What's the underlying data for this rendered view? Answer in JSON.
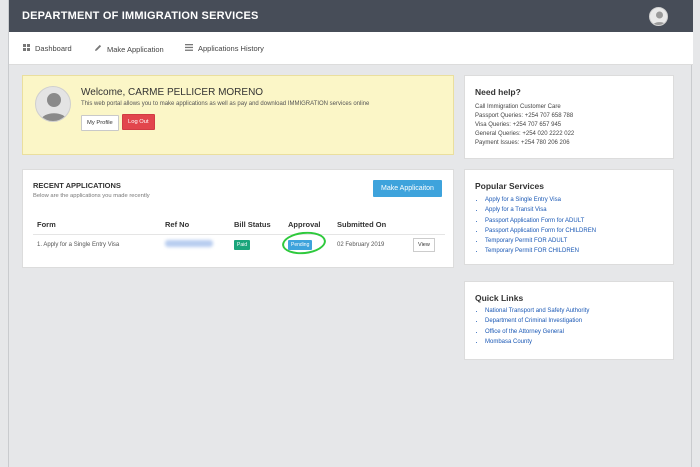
{
  "header": {
    "title": "DEPARTMENT OF IMMIGRATION SERVICES"
  },
  "nav": [
    {
      "label": "Dashboard",
      "icon": "dashboard-icon"
    },
    {
      "label": "Make Application",
      "icon": "pencil-icon"
    },
    {
      "label": "Applications History",
      "icon": "list-icon"
    }
  ],
  "welcome": {
    "title": "Welcome, CARME PELLICER MORENO",
    "subtitle": "This web portal allows you to make applications as well as pay and download IMMIGRATION services online",
    "profile_label": "My Profile",
    "logout_label": "Log Out"
  },
  "help": {
    "title": "Need help?",
    "lines": [
      "Call Immigration Customer Care",
      "Passport Queries: +254 707 658 788",
      "Visa Queries: +254 707 657 945",
      "General Queries: +254 020 2222 022",
      "Payment Issues: +254 780 206 206"
    ]
  },
  "recent": {
    "title": "RECENT APPLICATIONS",
    "subtitle": "Below are the applications you made recently",
    "make_label": "Make Applicaiton",
    "columns": [
      "Form",
      "Ref No",
      "Bill Status",
      "Approval",
      "Submitted On"
    ],
    "rows": [
      {
        "form": "1. Apply for a Single Entry Visa",
        "bill_status": "Paid",
        "approval": "Pending",
        "submitted": "02 February 2019",
        "action": "View"
      }
    ]
  },
  "popular": {
    "title": "Popular Services",
    "items": [
      "Apply for a Single Entry Visa",
      "Apply for a Transit Visa",
      "Passport Application Form for ADULT",
      "Passport Application Form for CHILDREN",
      "Temporary Permit FOR ADULT",
      "Temporary Permit FOR CHILDREN"
    ]
  },
  "quick": {
    "title": "Quick Links",
    "items": [
      "National Transport and Safety Authority",
      "Department of Criminal Investigation",
      "Office of the Attorney General",
      "Mombasa County"
    ]
  },
  "colors": {
    "header_bg": "#474d58",
    "welcome_bg": "#fbf6c7",
    "primary_blue": "#3ea3dc",
    "paid_green": "#1aa57b",
    "logout_red": "#e2454d",
    "link_blue": "#1a58b5",
    "highlight_circle": "#2ec93c"
  }
}
